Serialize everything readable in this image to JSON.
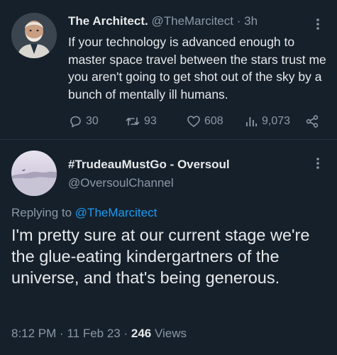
{
  "tweet": {
    "author_name": "The Architect.",
    "author_handle": "@TheMarcitect",
    "separator": "·",
    "time_ago": "3h",
    "text": "If your technology is advanced enough to master space travel between the stars trust me you aren't going to get shot out of the sky by a bunch of mentally ill humans.",
    "replies": "30",
    "retweets": "93",
    "likes": "608",
    "views": "9,073"
  },
  "reply": {
    "author_name": "#TrudeauMustGo - Oversoul",
    "author_handle": "@OversoulChannel",
    "replying_prefix": "Replying to",
    "replying_to": "@TheMarcitect",
    "text": "I'm pretty sure at our current stage we're the glue-eating kindergartners of the universe, and that's being generous.",
    "time": "8:12 PM",
    "date": "11 Feb 23",
    "separator": "·",
    "views_count": "246",
    "views_label": "Views"
  },
  "icons": {
    "reply": "reply-icon",
    "retweet": "retweet-icon",
    "like": "heart-icon",
    "views": "views-icon",
    "share": "share-icon",
    "more": "more-icon"
  },
  "colors": {
    "background": "#15202b",
    "text": "#e7e9ea",
    "secondary": "#8b98a5",
    "accent": "#1d9bf0",
    "divider": "#253341"
  }
}
